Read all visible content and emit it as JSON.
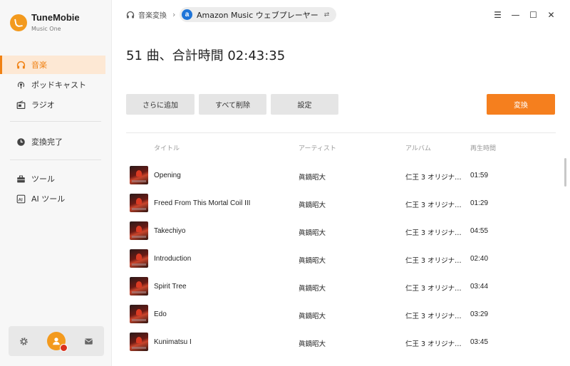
{
  "app": {
    "name": "TuneMobie",
    "subtitle": "Music One"
  },
  "sidebar": {
    "items": [
      {
        "label": "音楽",
        "icon": "headphones-icon",
        "active": true
      },
      {
        "label": "ポッドキャスト",
        "icon": "podcast-icon",
        "active": false
      },
      {
        "label": "ラジオ",
        "icon": "radio-icon",
        "active": false
      },
      {
        "label": "変換完了",
        "icon": "clock-icon",
        "active": false
      },
      {
        "label": "ツール",
        "icon": "toolbox-icon",
        "active": false
      },
      {
        "label": "AI ツール",
        "icon": "ai-icon",
        "active": false
      }
    ],
    "bottom": {
      "settings_icon": "gear-icon",
      "avatar_icon": "user-icon",
      "mail_icon": "mail-icon"
    }
  },
  "topbar": {
    "breadcrumb_label": "音楽変換",
    "chevron": "›",
    "source_label": "Amazon Music ウェブプレーヤー",
    "source_badge": "a",
    "swap_glyph": "⇄",
    "window_controls": {
      "menu": "☰",
      "minimize": "—",
      "maximize": "☐",
      "close": "✕"
    }
  },
  "main": {
    "count_title": "51 曲、合計時間 02:43:35",
    "buttons": {
      "add_more": "さらに追加",
      "delete_all": "すべて削除",
      "settings": "設定",
      "convert": "変換"
    },
    "columns": {
      "title": "タイトル",
      "artist": "アーティスト",
      "album": "アルバム",
      "duration": "再生時間"
    },
    "rows": [
      {
        "title": "Opening",
        "artist": "眞鍋昭大",
        "album": "仁王 3 オリジナ…",
        "duration": "01:59"
      },
      {
        "title": "Freed From This Mortal Coil III",
        "artist": "眞鍋昭大",
        "album": "仁王 3 オリジナ…",
        "duration": "01:29"
      },
      {
        "title": "Takechiyo",
        "artist": "眞鍋昭大",
        "album": "仁王 3 オリジナ…",
        "duration": "04:55"
      },
      {
        "title": "Introduction",
        "artist": "眞鍋昭大",
        "album": "仁王 3 オリジナ…",
        "duration": "02:40"
      },
      {
        "title": "Spirit Tree",
        "artist": "眞鍋昭大",
        "album": "仁王 3 オリジナ…",
        "duration": "03:44"
      },
      {
        "title": "Edo",
        "artist": "眞鍋昭大",
        "album": "仁王 3 オリジナ…",
        "duration": "03:29"
      },
      {
        "title": "Kunimatsu I",
        "artist": "眞鍋昭大",
        "album": "仁王 3 オリジナ…",
        "duration": "03:45"
      }
    ]
  },
  "colors": {
    "accent": "#f57f1e",
    "active_bg": "#fde8d4",
    "sidebar_bg": "#f7f7f7"
  }
}
